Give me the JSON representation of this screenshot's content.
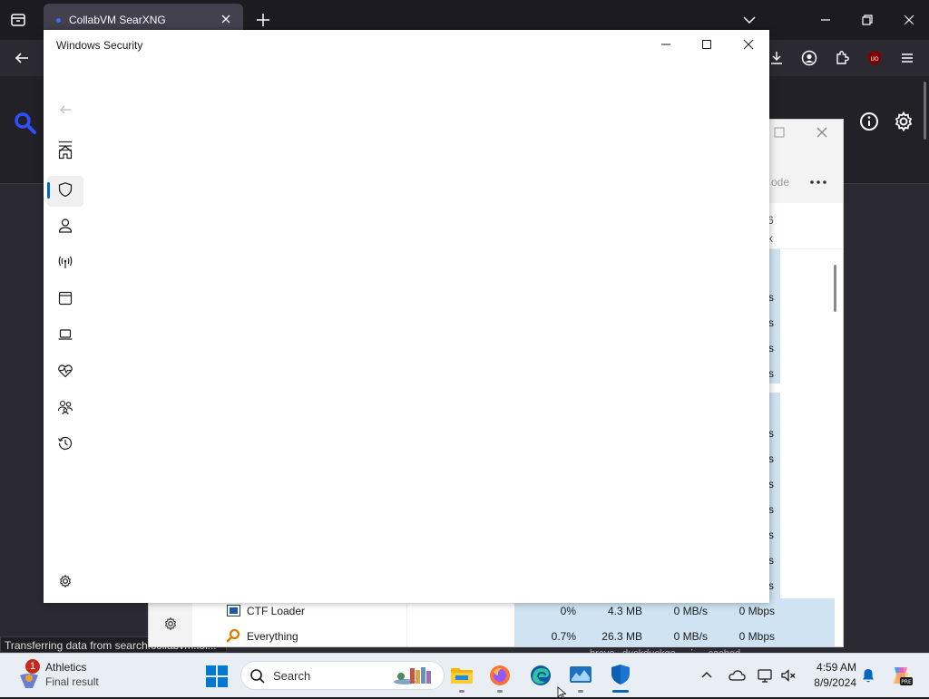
{
  "browser": {
    "tab_title": "CollabVM SearXNG",
    "status_text": "Transferring data from search.collabvm.lol..."
  },
  "task_manager": {
    "toolbar_partial": "ode",
    "header_partial_top": "6",
    "header_partial_bottom": "k",
    "rows": [
      {
        "name": "CTF Loader",
        "cpu": "0%",
        "memory": "4.3 MB",
        "disk": "0 MB/s",
        "network": "0 Mbps"
      },
      {
        "name": "Everything",
        "cpu": "0.7%",
        "memory": "26.3 MB",
        "disk": "0 MB/s",
        "network": "0 Mbps"
      }
    ],
    "partial_network_cells": [
      "s",
      "s",
      "s",
      "s",
      "s",
      "s",
      "s",
      "s",
      "s",
      "s",
      "s",
      "s"
    ],
    "footer_links": [
      "brave",
      "duckduckgo",
      "cached"
    ]
  },
  "windows_security": {
    "title": "Windows Security"
  },
  "taskbar": {
    "weather_badge": "1",
    "weather_title": "Athletics",
    "weather_subtitle": "Final result",
    "search_placeholder": "Search",
    "time": "4:59 AM",
    "date": "8/9/2024"
  },
  "colors": {
    "accent": "#0067c0",
    "browser_bg": "#1c1b22",
    "searx_blue": "#3050ff"
  }
}
